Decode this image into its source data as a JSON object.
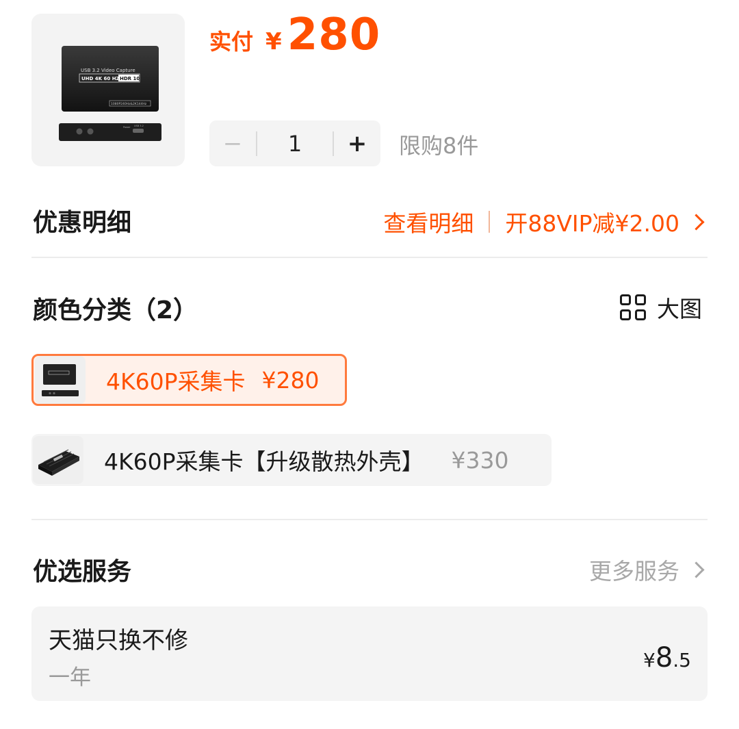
{
  "product": {
    "image_text": {
      "line1": "USB 3.2 Video Capture",
      "line2": "UHD 4K 60 HZ",
      "badge": "HDR 10",
      "spec": "1080P240Hz&2K144Hz",
      "port_labels": [
        "Power",
        "USB 3.2"
      ]
    },
    "price_label": "实付",
    "currency": "¥",
    "price": "280"
  },
  "quantity": {
    "minus": "−",
    "value": "1",
    "plus": "+",
    "limit": "限购8件"
  },
  "discount": {
    "title": "优惠明细",
    "view_detail": "查看明细",
    "vip_offer": "开88VIP减¥2.00"
  },
  "color": {
    "title": "颜色分类（2）",
    "big_image": "大图",
    "options": [
      {
        "name": "4K60P采集卡",
        "price": "¥280",
        "selected": true
      },
      {
        "name": "4K60P采集卡【升级散热外壳】",
        "price": "¥330",
        "selected": false
      }
    ]
  },
  "services": {
    "title": "优选服务",
    "more": "更多服务",
    "items": [
      {
        "name": "天猫只换不修",
        "period": "一年",
        "currency": "¥",
        "price_int": "8",
        "price_dec": ".5"
      }
    ]
  },
  "colors": {
    "accent": "#ff5000",
    "selected_bg": "#fff1ea",
    "muted": "#999999"
  }
}
